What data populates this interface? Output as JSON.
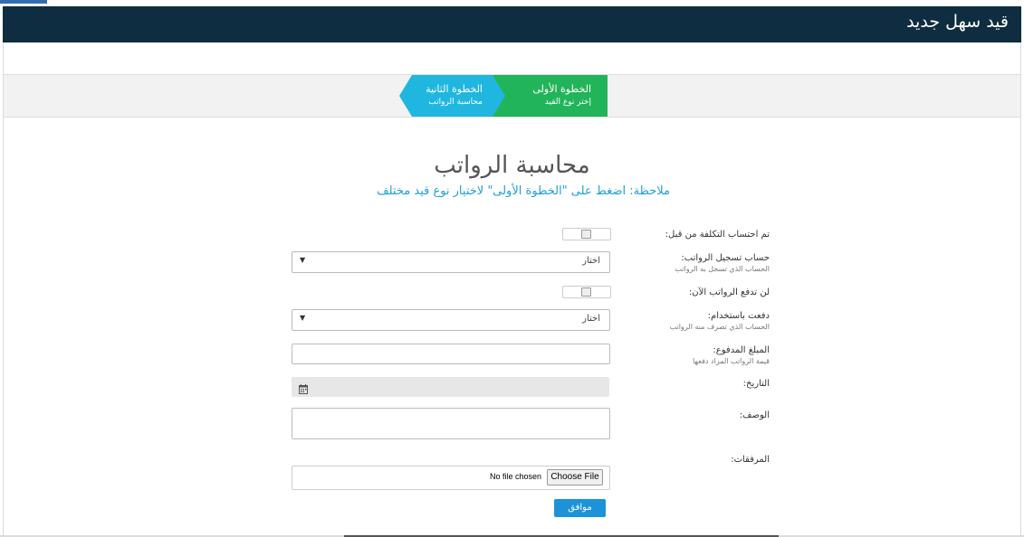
{
  "header": {
    "title": "قيد سهل جديد"
  },
  "wizard": {
    "step1": {
      "title": "الخطوة الأولى",
      "subtitle": "إختر نوع القيد",
      "color": "#22b45a"
    },
    "step2": {
      "title": "الخطوة الثانية",
      "subtitle": "محاسبة الرواتب",
      "color": "#1fb6e0"
    }
  },
  "main": {
    "title": "محاسبة الرواتب",
    "note": "ملاحظة: اضغط على \"الخطوة الأولى\" لاختيار نوع قيد مختلف"
  },
  "form": {
    "cost_calculated_label": "تم احتساب التكلفة من قبل:",
    "salary_account_label": "حساب تسجيل الرواتب:",
    "salary_account_help": "الحساب الذي تسجل به الرواتب",
    "salary_account_value": "اختار",
    "not_paid_label": "لن تدفع الرواتب الآن:",
    "paid_using_label": "دفعت باستخدام:",
    "paid_using_help": "الحساب الذي تصرف منه الرواتب",
    "paid_using_value": "اختار",
    "amount_label": "المبلغ المدفوع:",
    "amount_help": "قيمة الرواتب المراد دفعها",
    "date_label": "التاريخ:",
    "description_label": "الوصف:",
    "attachments_label": "المرفقات:",
    "choose_file": "Choose File",
    "no_file": "No file chosen",
    "submit": "موافق"
  },
  "colors": {
    "header_bg": "#0f2d40",
    "accent": "#1c93d8"
  }
}
